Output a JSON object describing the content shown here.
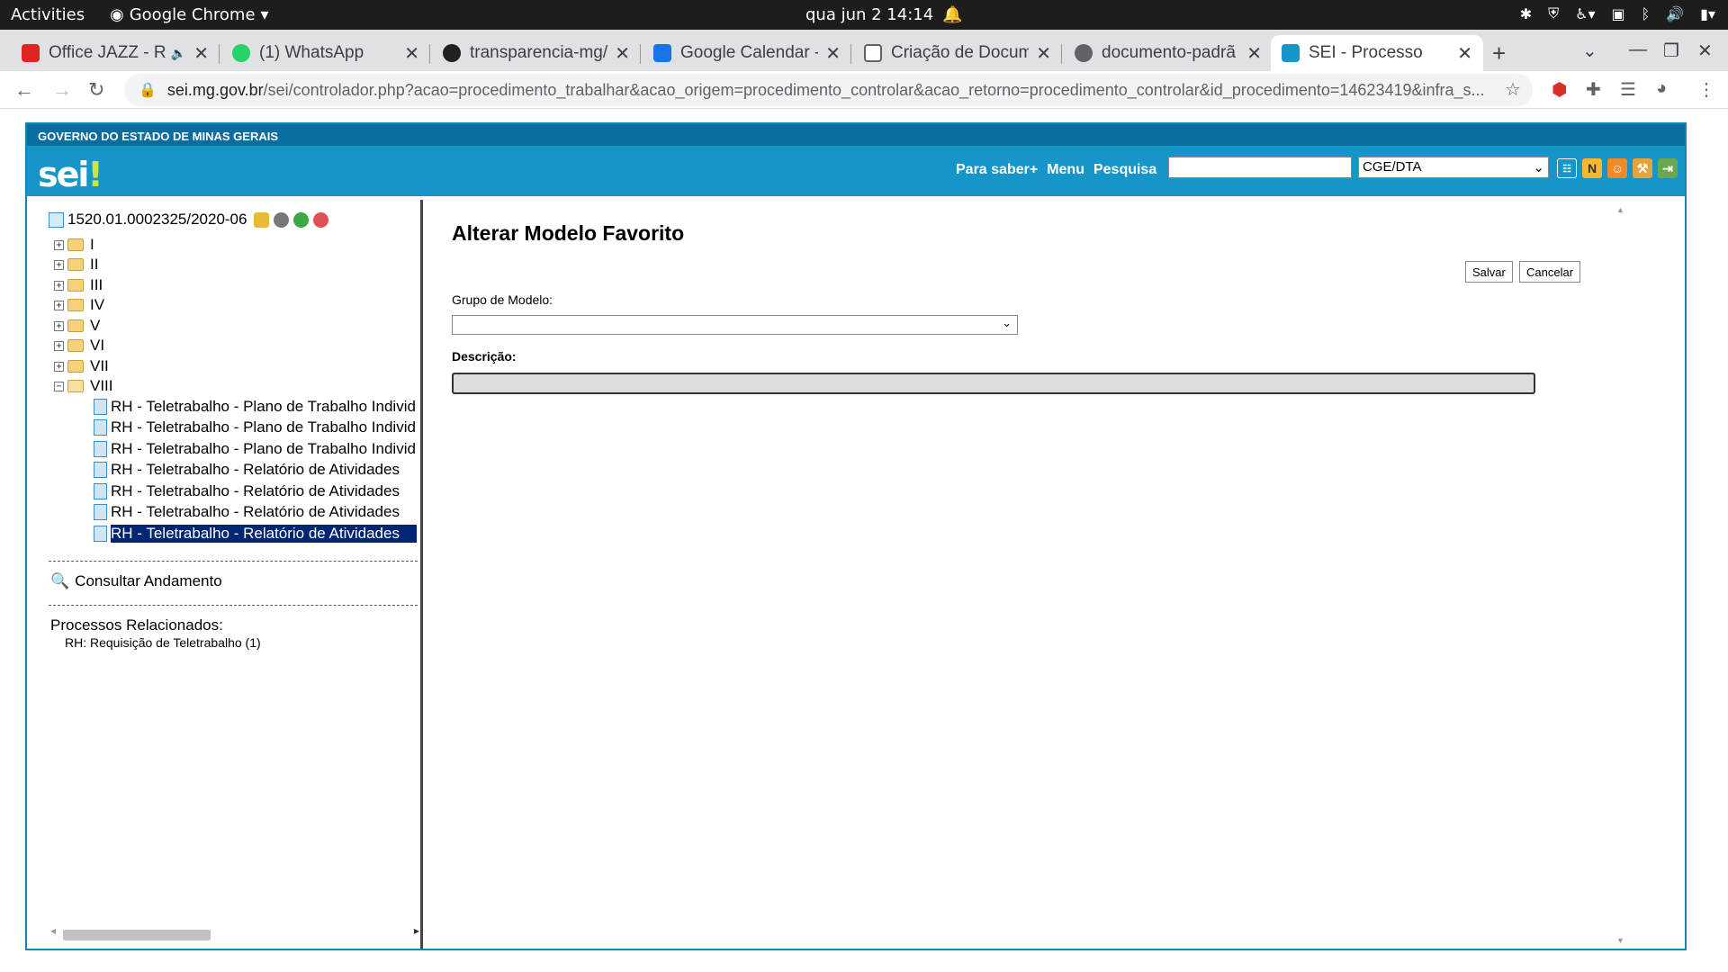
{
  "os": {
    "activities": "Activities",
    "app_name": "Google Chrome",
    "clock": "qua jun 2  14:14"
  },
  "browser": {
    "tabs": [
      {
        "title": "Office JAZZ - R",
        "favicon_color": "#e02424"
      },
      {
        "title": "(1) WhatsApp",
        "favicon_color": "#25d366"
      },
      {
        "title": "transparencia-mg/",
        "favicon_color": "#202124"
      },
      {
        "title": "Google Calendar -",
        "favicon_color": "#1a73e8"
      },
      {
        "title": "Criação de Docum",
        "favicon_color": "#5f6368"
      },
      {
        "title": "documento-padrã",
        "favicon_color": "#5f6368"
      },
      {
        "title": "SEI - Processo",
        "favicon_color": "#1696c8"
      }
    ],
    "url_host": "sei.mg.gov.br",
    "url_path": "/sei/controlador.php?acao=procedimento_trabalhar&acao_origem=procedimento_controlar&acao_retorno=procedimento_controlar&id_procedimento=14623419&infra_s..."
  },
  "sei": {
    "gov_label": "GOVERNO DO ESTADO DE MINAS GERAIS",
    "logo": "sei",
    "logo_excl": "!",
    "link_para_saber": "Para saber+",
    "link_menu": "Menu",
    "link_pesquisa": "Pesquisa",
    "unit_selected": "CGE/DTA",
    "brand_color": "#1696c8",
    "gov_bar_color": "#0b6c9e"
  },
  "tree": {
    "process_number": "1520.01.0002325/2020-06",
    "folders": [
      "I",
      "II",
      "III",
      "IV",
      "V",
      "VI",
      "VII",
      "VIII"
    ],
    "documents": [
      "RH - Teletrabalho - Plano de Trabalho Individual",
      "RH - Teletrabalho - Plano de Trabalho Individual",
      "RH - Teletrabalho - Plano de Trabalho Individual",
      "RH - Teletrabalho - Relatório de Atividades",
      "RH - Teletrabalho - Relatório de Atividades",
      "RH - Teletrabalho - Relatório de Atividades",
      "RH - Teletrabalho - Relatório de Atividades"
    ],
    "consultar": "Consultar Andamento",
    "relacionados_title": "Processos Relacionados:",
    "relacionados_item": "RH: Requisição de Teletrabalho (1)"
  },
  "form": {
    "title": "Alterar Modelo Favorito",
    "save_label": "Salvar",
    "cancel_label": "Cancelar",
    "grupo_label": "Grupo de Modelo:",
    "grupo_value": "",
    "descricao_label": "Descrição:",
    "descricao_value": ""
  }
}
